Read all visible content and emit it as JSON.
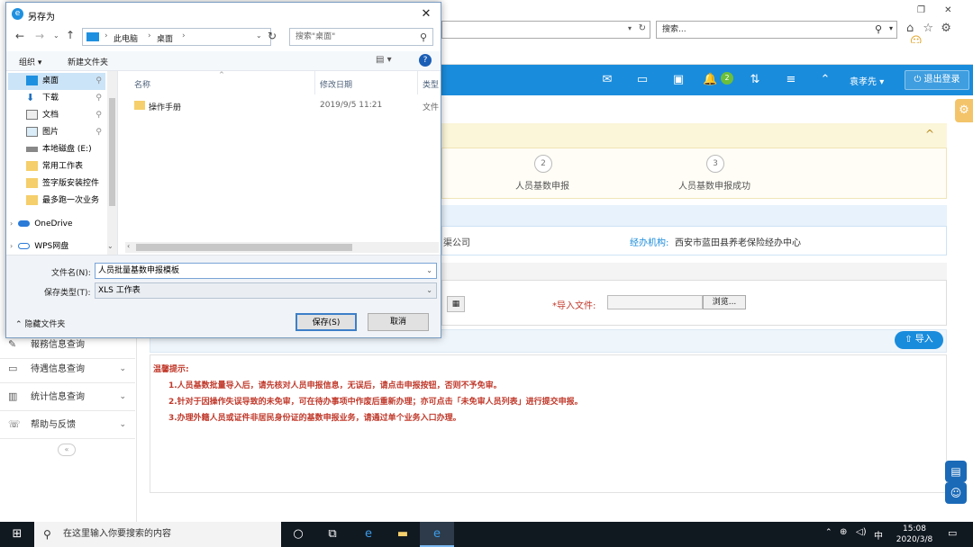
{
  "browser": {
    "search_placeholder": "搜索...",
    "tab_buttons": [
      "⌂",
      "☆",
      "⚙",
      "☺"
    ]
  },
  "header": {
    "notification_count": "2",
    "user_name": "袁孝先",
    "logout_label": "退出登录",
    "accent": "#1a8cdc"
  },
  "sidebar": {
    "items": [
      {
        "label": "報務信息查询",
        "icon": "message-icon"
      },
      {
        "label": "待遇信息查询",
        "icon": "card-icon"
      },
      {
        "label": "统计信息查询",
        "icon": "chart-icon"
      },
      {
        "label": "帮助与反馈",
        "icon": "chat-icon"
      }
    ],
    "collapse_label": "«"
  },
  "steps": {
    "items": [
      {
        "num": "2",
        "label": "人员基数申报"
      },
      {
        "num": "3",
        "label": "人员基数申报成功"
      }
    ],
    "collapse_icon": "^"
  },
  "info": {
    "company_suffix": "渠公司",
    "agency_label": "经办机构:",
    "agency_value": "西安市蓝田县养老保险经办中心"
  },
  "form": {
    "import_file_label": "*导入文件:",
    "browse_label": "浏览...",
    "import_button": "导入"
  },
  "tips": {
    "title": "温馨提示:",
    "lines": [
      "1.人员基数批量导入后，请先核对人员申报信息，无误后，请点击申报按钮，否则不予免审。",
      "2.针对于因操作失误导致的未免审，可在待办事项中作废后重新办理；亦可点击「未免审人员列表」进行提交申报。",
      "3.办理外籍人员或证件非居民身份证的基数申报业务，请通过单个业务入口办理。"
    ]
  },
  "dialog": {
    "title": "另存为",
    "path": [
      "此电脑",
      "桌面"
    ],
    "search_placeholder": "搜索\"桌面\"",
    "organize_label": "组织 ▾",
    "new_folder_label": "新建文件夹",
    "nav_items": [
      {
        "label": "桌面",
        "icon": "desktop-icon",
        "pinned": true,
        "selected": true
      },
      {
        "label": "下载",
        "icon": "download-icon",
        "pinned": true
      },
      {
        "label": "文档",
        "icon": "document-icon",
        "pinned": true
      },
      {
        "label": "图片",
        "icon": "picture-icon",
        "pinned": true
      },
      {
        "label": "本地磁盘 (E:)",
        "icon": "drive-icon"
      },
      {
        "label": "常用工作表",
        "icon": "folder-icon"
      },
      {
        "label": "签字版安装控件",
        "icon": "folder-icon"
      },
      {
        "label": "最多跑一次业务",
        "icon": "folder-icon"
      },
      {
        "label": "OneDrive",
        "icon": "cloud-icon"
      },
      {
        "label": "WPS网盘",
        "icon": "cloud-icon"
      }
    ],
    "columns": [
      "名称",
      "修改日期",
      "类型"
    ],
    "files": [
      {
        "name": "操作手册",
        "date": "2019/9/5 11:21",
        "type": "文件"
      }
    ],
    "filename_label": "文件名(N):",
    "filename_value": "人员批量基数申报模板",
    "filetype_label": "保存类型(T):",
    "filetype_value": "XLS 工作表",
    "hide_folders_label": "隐藏文件夹",
    "save_label": "保存(S)",
    "cancel_label": "取消"
  },
  "taskbar": {
    "search_placeholder": "在这里输入你要搜索的内容",
    "ime": "中",
    "time": "15:08",
    "date": "2020/3/8"
  }
}
